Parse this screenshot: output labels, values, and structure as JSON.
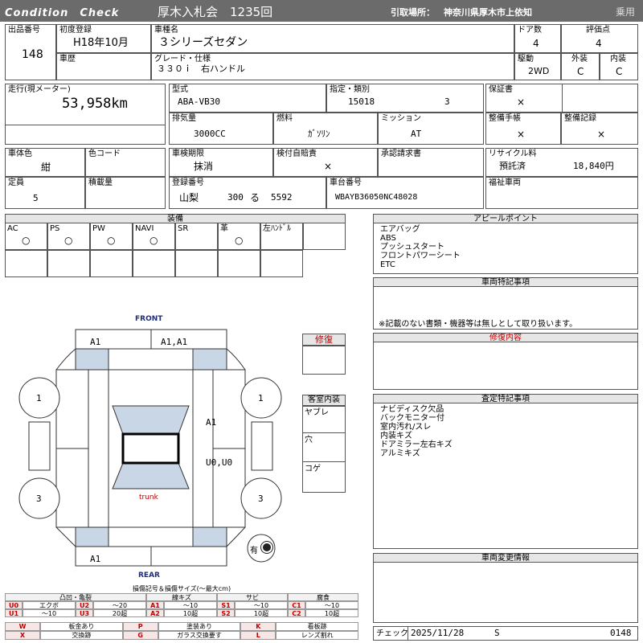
{
  "header": {
    "logo": "Condition　Check",
    "auction": "厚木入札会　1235回",
    "pickup_label": "引取場所：",
    "pickup_location": "神奈川県厚木市上依知",
    "category": "乗用"
  },
  "vehicle": {
    "lot_label": "出品番号",
    "lot_value": "148",
    "first_reg_label": "初度登録",
    "first_reg_value": "H18年10月",
    "model_name_label": "車種名",
    "model_name_value": "３シリーズセダン",
    "doors_label": "ドア数",
    "doors_value": "4",
    "score_label": "評価点",
    "score_value": "4",
    "history_label": "車歴",
    "grade_label": "グレード・仕様",
    "grade_value": "３３０ｉ　右ハンドル",
    "drive_label": "駆動",
    "drive_value": "2WD",
    "exterior_label": "外装",
    "exterior_value": "C",
    "interior_label": "内装",
    "interior_value": "C",
    "mileage_label": "走行(現メーター)",
    "mileage_value": "53,958km",
    "type_label": "型式",
    "type_value": "ABA-VB30",
    "designation_label": "指定・類別",
    "designation_value": "15018",
    "class_value": "3",
    "warranty_label": "保証書",
    "warranty_value": "×",
    "displacement_label": "排気量",
    "displacement_value": "3000CC",
    "fuel_label": "燃料",
    "fuel_value": "ｶﾞｿﾘﾝ",
    "mission_label": "ミッション",
    "mission_value": "AT",
    "manual_label": "整備手帳",
    "manual_value": "×",
    "maint_label": "整備記録",
    "maint_value": "×",
    "color_label": "車体色",
    "color_value": "紺",
    "color_code_label": "色コード",
    "inspection_label": "車検期限",
    "inspection_value": "抹消",
    "liability_label": "検付自賠責",
    "liability_value": "×",
    "approval_label": "承認請求書",
    "recycle_label": "リサイクル料",
    "recycle_status": "預託済",
    "recycle_value": "18,840円",
    "capacity_label": "定員",
    "capacity_value": "5",
    "load_label": "積載量",
    "plate_label": "登録番号",
    "plate_area": "山梨",
    "plate_class": "300",
    "plate_kana": "る",
    "plate_number": "5592",
    "chassis_label": "車台番号",
    "chassis_value": "WBAYB36050NC48028",
    "welfare_label": "福祉車両"
  },
  "equipment": {
    "title": "装備",
    "items": [
      {
        "label": "AC",
        "value": "○"
      },
      {
        "label": "PS",
        "value": "○"
      },
      {
        "label": "PW",
        "value": "○"
      },
      {
        "label": "NAVI",
        "value": "○"
      },
      {
        "label": "SR",
        "value": ""
      },
      {
        "label": "革",
        "value": "○"
      },
      {
        "label": "左ﾊﾝﾄﾞﾙ",
        "value": ""
      }
    ]
  },
  "appeal": {
    "title": "アピールポイント",
    "lines": [
      "エアバッグ",
      "ABS",
      "プッシュスタート",
      "フロントパワーシート",
      "ETC"
    ]
  },
  "special": {
    "title": "車両特記事項",
    "note": "※記載のない書類・機器等は無しとして取り扱います。"
  },
  "repair_content": {
    "title": "修復内容"
  },
  "inspector_notes": {
    "title": "査定特記事項",
    "lines": [
      "ナビディスク欠品",
      "バックモニター付",
      "室内汚れ/スレ",
      "内装キズ",
      "ドアミラー左右キズ",
      "アルミキズ"
    ]
  },
  "change_info": {
    "title": "車両変更情報"
  },
  "diagram": {
    "front_label": "FRONT",
    "rear_label": "REAR",
    "trunk_label": "trunk",
    "marks": {
      "front_left": "A1",
      "front_right": "A1,A1",
      "right_door_front": "A1",
      "right_door_rear": "U0,U0",
      "rear_left": "A1",
      "tire_fl": "1",
      "tire_fr": "1",
      "tire_rl": "3",
      "tire_rr": "3"
    },
    "spare_label": "有",
    "repair_label": "修復",
    "interior_label": "客室内装",
    "interior_items": [
      "ヤブレ",
      "穴",
      "コゲ"
    ]
  },
  "legend": {
    "title": "損傷記号＆損傷サイズ(〜最大cm)",
    "groups": [
      "凸凹・亀裂",
      "線キズ",
      "サビ",
      "腐食"
    ],
    "sub": "エクボ",
    "rows": [
      [
        {
          "c": "U0",
          "t": "エクボ"
        },
        {
          "c": "U2",
          "t": "〜20"
        },
        {
          "c": "A1",
          "t": "〜10"
        },
        {
          "c": "S1",
          "t": "〜10"
        },
        {
          "c": "C1",
          "t": "〜10"
        }
      ],
      [
        {
          "c": "U1",
          "t": "〜10"
        },
        {
          "c": "U3",
          "t": "20超"
        },
        {
          "c": "A2",
          "t": "10超"
        },
        {
          "c": "S2",
          "t": "10超"
        },
        {
          "c": "C2",
          "t": "10超"
        }
      ]
    ],
    "codes": [
      [
        {
          "c": "W",
          "t": "板金あり"
        },
        {
          "c": "P",
          "t": "塗装あり"
        },
        {
          "c": "K",
          "t": "看板跡"
        }
      ],
      [
        {
          "c": "X",
          "t": "交換跡"
        },
        {
          "c": "G",
          "t": "ガラス交換要す"
        },
        {
          "c": "L",
          "t": "レンズ割れ"
        }
      ]
    ]
  },
  "footer": {
    "check_label": "チェック",
    "check_date": "2025/11/28",
    "check_code": "S",
    "check_number": "0148"
  },
  "colors": {
    "header_bg": "#6b6b6b",
    "highlight": "#c00000",
    "panel_fill": "#c9d6e6"
  }
}
